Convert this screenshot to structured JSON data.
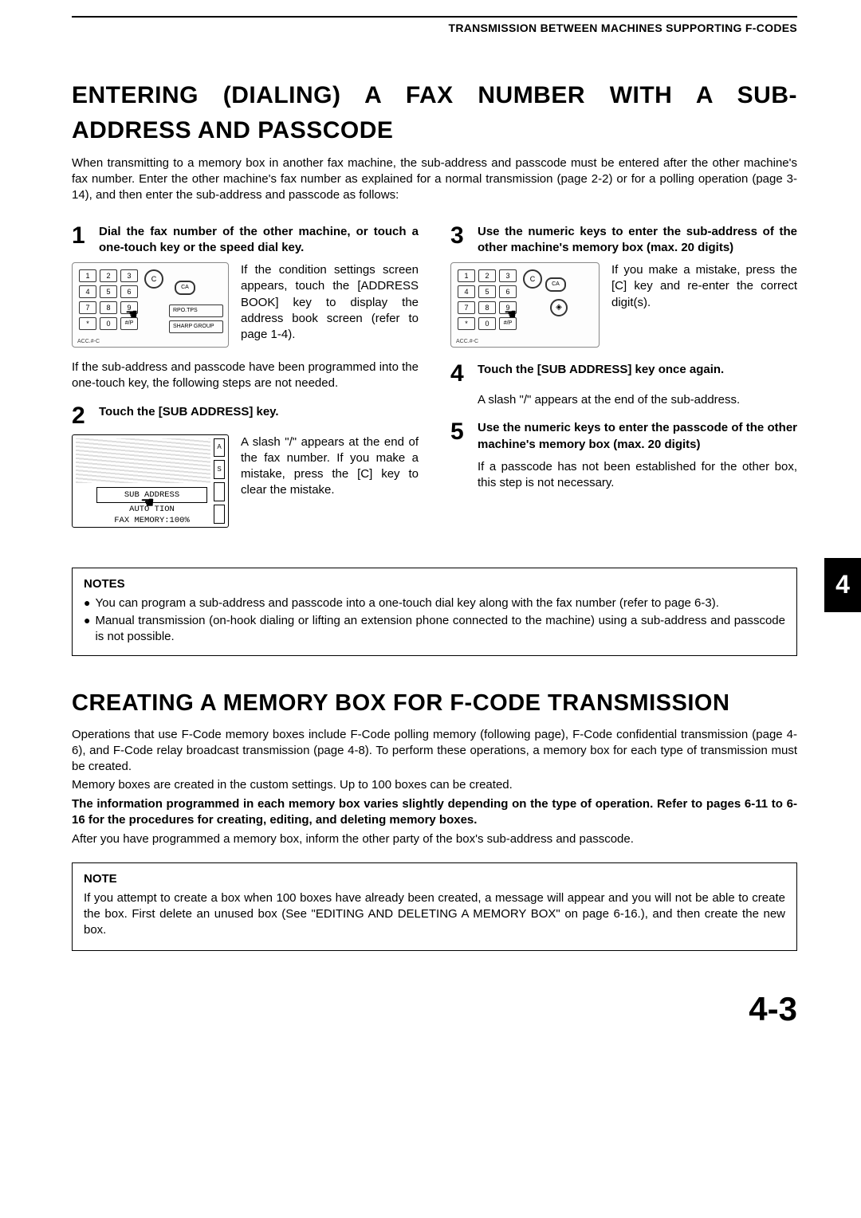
{
  "header": {
    "title": "TRANSMISSION BETWEEN MACHINES SUPPORTING F-CODES"
  },
  "side_tab": "4",
  "footer_page": "4-3",
  "section1": {
    "title_line1": "ENTERING (DIALING) A FAX NUMBER WITH A SUB-",
    "title_line2": "ADDRESS AND PASSCODE",
    "intro": "When transmitting to a memory box in another fax machine, the sub-address and passcode must be entered after the other machine's fax number. Enter the other machine's fax number as explained for a normal transmission (page 2-2) or for a polling operation (page 3-14), and then enter the sub-address and passcode as follows:"
  },
  "steps": {
    "s1": {
      "num": "1",
      "title": "Dial the fax number of the other machine, or touch a one-touch key or the speed dial key.",
      "body": "If the condition settings screen appears, touch the [ADDRESS BOOK] key to display the address book screen (refer to page 1-4).",
      "cont": "If the sub-address and passcode have been programmed into the one-touch key, the following steps are not needed."
    },
    "s2": {
      "num": "2",
      "title": "Touch the [SUB ADDRESS] key.",
      "body": "A slash \"/\" appears at the end of the fax number. If you make a mistake, press the [C] key to clear the mistake."
    },
    "s3": {
      "num": "3",
      "title": "Use the numeric keys to enter the sub-address of the other machine's memory box (max. 20 digits)",
      "body": "If you make a mistake, press the [C] key and re-enter the correct digit(s)."
    },
    "s4": {
      "num": "4",
      "title": "Touch the [SUB ADDRESS] key once again.",
      "body": "A slash \"/\" appears at the end of the sub-address."
    },
    "s5": {
      "num": "5",
      "title": "Use the numeric keys to enter the passcode of the other machine's memory box (max. 20 digits)",
      "body": "If a passcode has not been established for the other box, this step is not necessary."
    }
  },
  "figures": {
    "keypad": {
      "keys": [
        "1",
        "2",
        "3",
        "4",
        "5",
        "6",
        "7",
        "8",
        "9",
        "*",
        "0",
        "#/P"
      ],
      "c_label": "C",
      "ca_label": "CA",
      "acc_label": "ACC.#-C",
      "slot1": "RPO.TPS",
      "slot2": "SHARP GROUP"
    },
    "lcd": {
      "button": "SUB ADDRESS",
      "line2": "AUTO      TION",
      "line3": "FAX MEMORY:100%",
      "sidebtns": [
        "A",
        "S",
        "",
        ""
      ]
    }
  },
  "notes1": {
    "title": "NOTES",
    "b1": "You can program a sub-address and passcode into a one-touch dial key along with the fax number (refer to page 6-3).",
    "b2": "Manual transmission (on-hook dialing or lifting an extension phone connected to the machine) using a sub-address and passcode is not possible."
  },
  "section2": {
    "title": "CREATING A MEMORY BOX FOR F-CODE TRANSMISSION",
    "p1": "Operations that use F-Code memory boxes include F-Code polling memory (following page), F-Code confidential transmission (page 4-6), and F-Code relay broadcast transmission (page 4-8). To perform these operations, a memory box for each type of transmission must be created.",
    "p2": "Memory boxes are created in the custom settings. Up to 100 boxes can be created.",
    "p3": "The information programmed in each memory box varies slightly depending on the type of operation. Refer to pages 6-11 to 6-16 for the procedures for creating, editing, and deleting memory boxes.",
    "p4": "After you have programmed a memory box, inform the other party of the box's sub-address and passcode."
  },
  "note2": {
    "title": "NOTE",
    "body": "If you attempt to create a box when 100 boxes have already been created, a message will appear and you will not be able to create the box. First delete an unused box (See \"EDITING AND DELETING A MEMORY BOX\" on page 6-16.), and then create the new box."
  }
}
